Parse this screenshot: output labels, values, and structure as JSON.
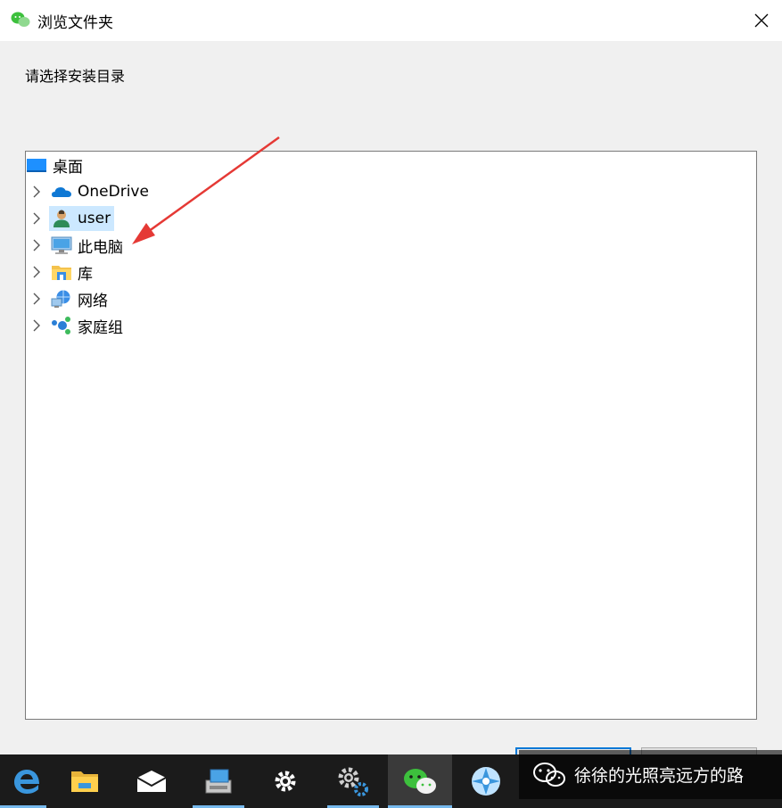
{
  "window": {
    "title": "浏览文件夹",
    "icon": "wechat-icon"
  },
  "prompt": "请选择安装目录",
  "tree": {
    "root": {
      "label": "桌面",
      "icon": "desktop-icon"
    },
    "items": [
      {
        "label": "OneDrive",
        "icon": "onedrive-icon"
      },
      {
        "label": "user",
        "icon": "user-icon",
        "selected": true
      },
      {
        "label": "此电脑",
        "icon": "computer-icon"
      },
      {
        "label": "库",
        "icon": "library-icon"
      },
      {
        "label": "网络",
        "icon": "network-icon"
      },
      {
        "label": "家庭组",
        "icon": "homegroup-icon"
      }
    ]
  },
  "taskbar": {
    "items": [
      "edge-icon",
      "file-explorer-icon",
      "mail-icon",
      "installer-icon",
      "settings-icon",
      "gears-icon",
      "wechat-icon",
      "app-icon"
    ]
  },
  "watermark": {
    "text": "徐徐的光照亮远方的路"
  },
  "colors": {
    "accent": "#0078d7",
    "selection": "#cce8ff",
    "arrow": "#e53935",
    "wechat_green": "#3dc03d"
  }
}
